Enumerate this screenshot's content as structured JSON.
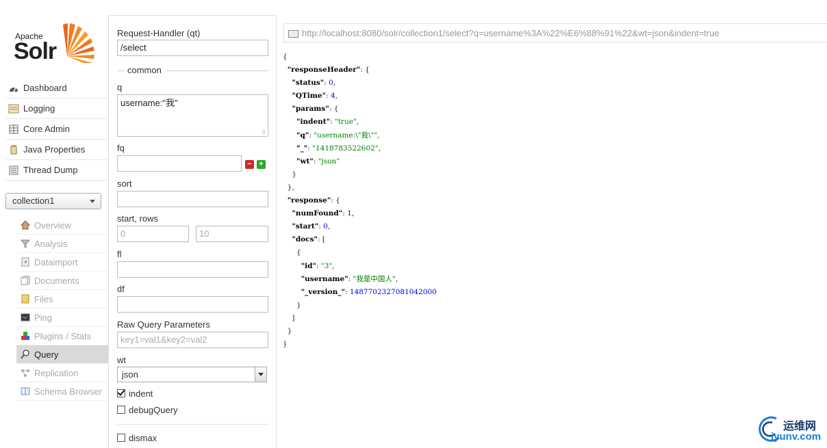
{
  "logo": {
    "apache": "Apache",
    "solr": "Solr"
  },
  "nav": [
    {
      "label": "Dashboard",
      "icon": "dashboard-icon"
    },
    {
      "label": "Logging",
      "icon": "logging-icon"
    },
    {
      "label": "Core Admin",
      "icon": "core-admin-icon"
    },
    {
      "label": "Java Properties",
      "icon": "java-icon"
    },
    {
      "label": "Thread Dump",
      "icon": "thread-dump-icon"
    }
  ],
  "core_selector": {
    "value": "collection1"
  },
  "core_nav": [
    {
      "label": "Overview",
      "icon": "home-icon"
    },
    {
      "label": "Analysis",
      "icon": "filter-icon"
    },
    {
      "label": "Dataimport",
      "icon": "dataimport-icon"
    },
    {
      "label": "Documents",
      "icon": "documents-icon"
    },
    {
      "label": "Files",
      "icon": "files-icon"
    },
    {
      "label": "Ping",
      "icon": "ping-icon"
    },
    {
      "label": "Plugins / Stats",
      "icon": "plugins-icon"
    },
    {
      "label": "Query",
      "icon": "query-icon",
      "active": true
    },
    {
      "label": "Replication",
      "icon": "replication-icon"
    },
    {
      "label": "Schema Browser",
      "icon": "schema-icon"
    }
  ],
  "form": {
    "handler_label": "Request-Handler (qt)",
    "handler_value": "/select",
    "common_legend": "common",
    "q_label": "q",
    "q_value": "username:\"我\"",
    "fq_label": "fq",
    "fq_value": "",
    "sort_label": "sort",
    "sort_value": "",
    "start_rows_label": "start, rows",
    "start_placeholder": "0",
    "rows_placeholder": "10",
    "fl_label": "fl",
    "df_label": "df",
    "raw_label": "Raw Query Parameters",
    "raw_placeholder": "key1=val1&key2=val2",
    "wt_label": "wt",
    "wt_value": "json",
    "indent_label": "indent",
    "indent_checked": true,
    "debug_label": "debugQuery",
    "debug_checked": false,
    "dismax_label": "dismax",
    "dismax_checked": false
  },
  "result": {
    "url": "http://localhost:8080/solr/collection1/select?q=username%3A%22%E6%88%91%22&wt=json&indent=true",
    "json": {
      "responseHeader": {
        "status": 0,
        "QTime": 4,
        "params": {
          "indent": "true",
          "q": "username:\\\"我\\\"",
          "_": "1418783522602",
          "wt": "json"
        }
      },
      "response": {
        "numFound": 1,
        "start": 0,
        "docs": [
          {
            "id": "3",
            "username": "我是中国人",
            "_version_": "1487702327081042000"
          }
        ]
      }
    }
  },
  "watermark": {
    "line1": "运维网",
    "line2": "iyunv.com"
  },
  "colors": {
    "active_nav_bg": "#d9d9d9",
    "json_string": "#008000",
    "json_number": "#0000dd",
    "logo_orange": "#f37920"
  }
}
